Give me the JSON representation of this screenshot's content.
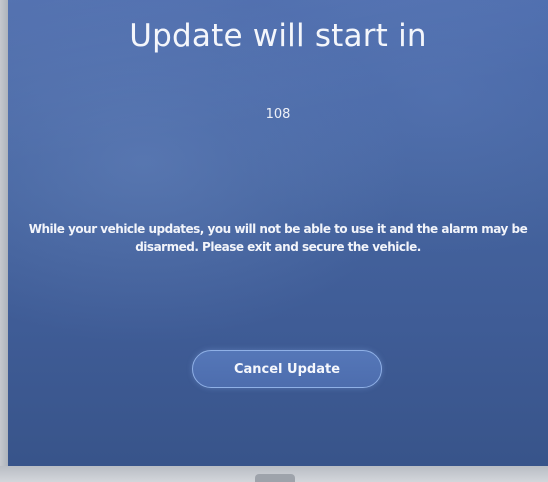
{
  "dialog": {
    "title": "Update will start in",
    "countdown": "108",
    "message_line1": "While your vehicle updates, you will not be able to use it and the alarm may be",
    "message_line2": "disarmed. Please exit and secure the vehicle.",
    "cancel_label": "Cancel Update"
  },
  "colors": {
    "background": "#45649f",
    "text": "#ffffff",
    "button_border": "#8fb0e6"
  }
}
